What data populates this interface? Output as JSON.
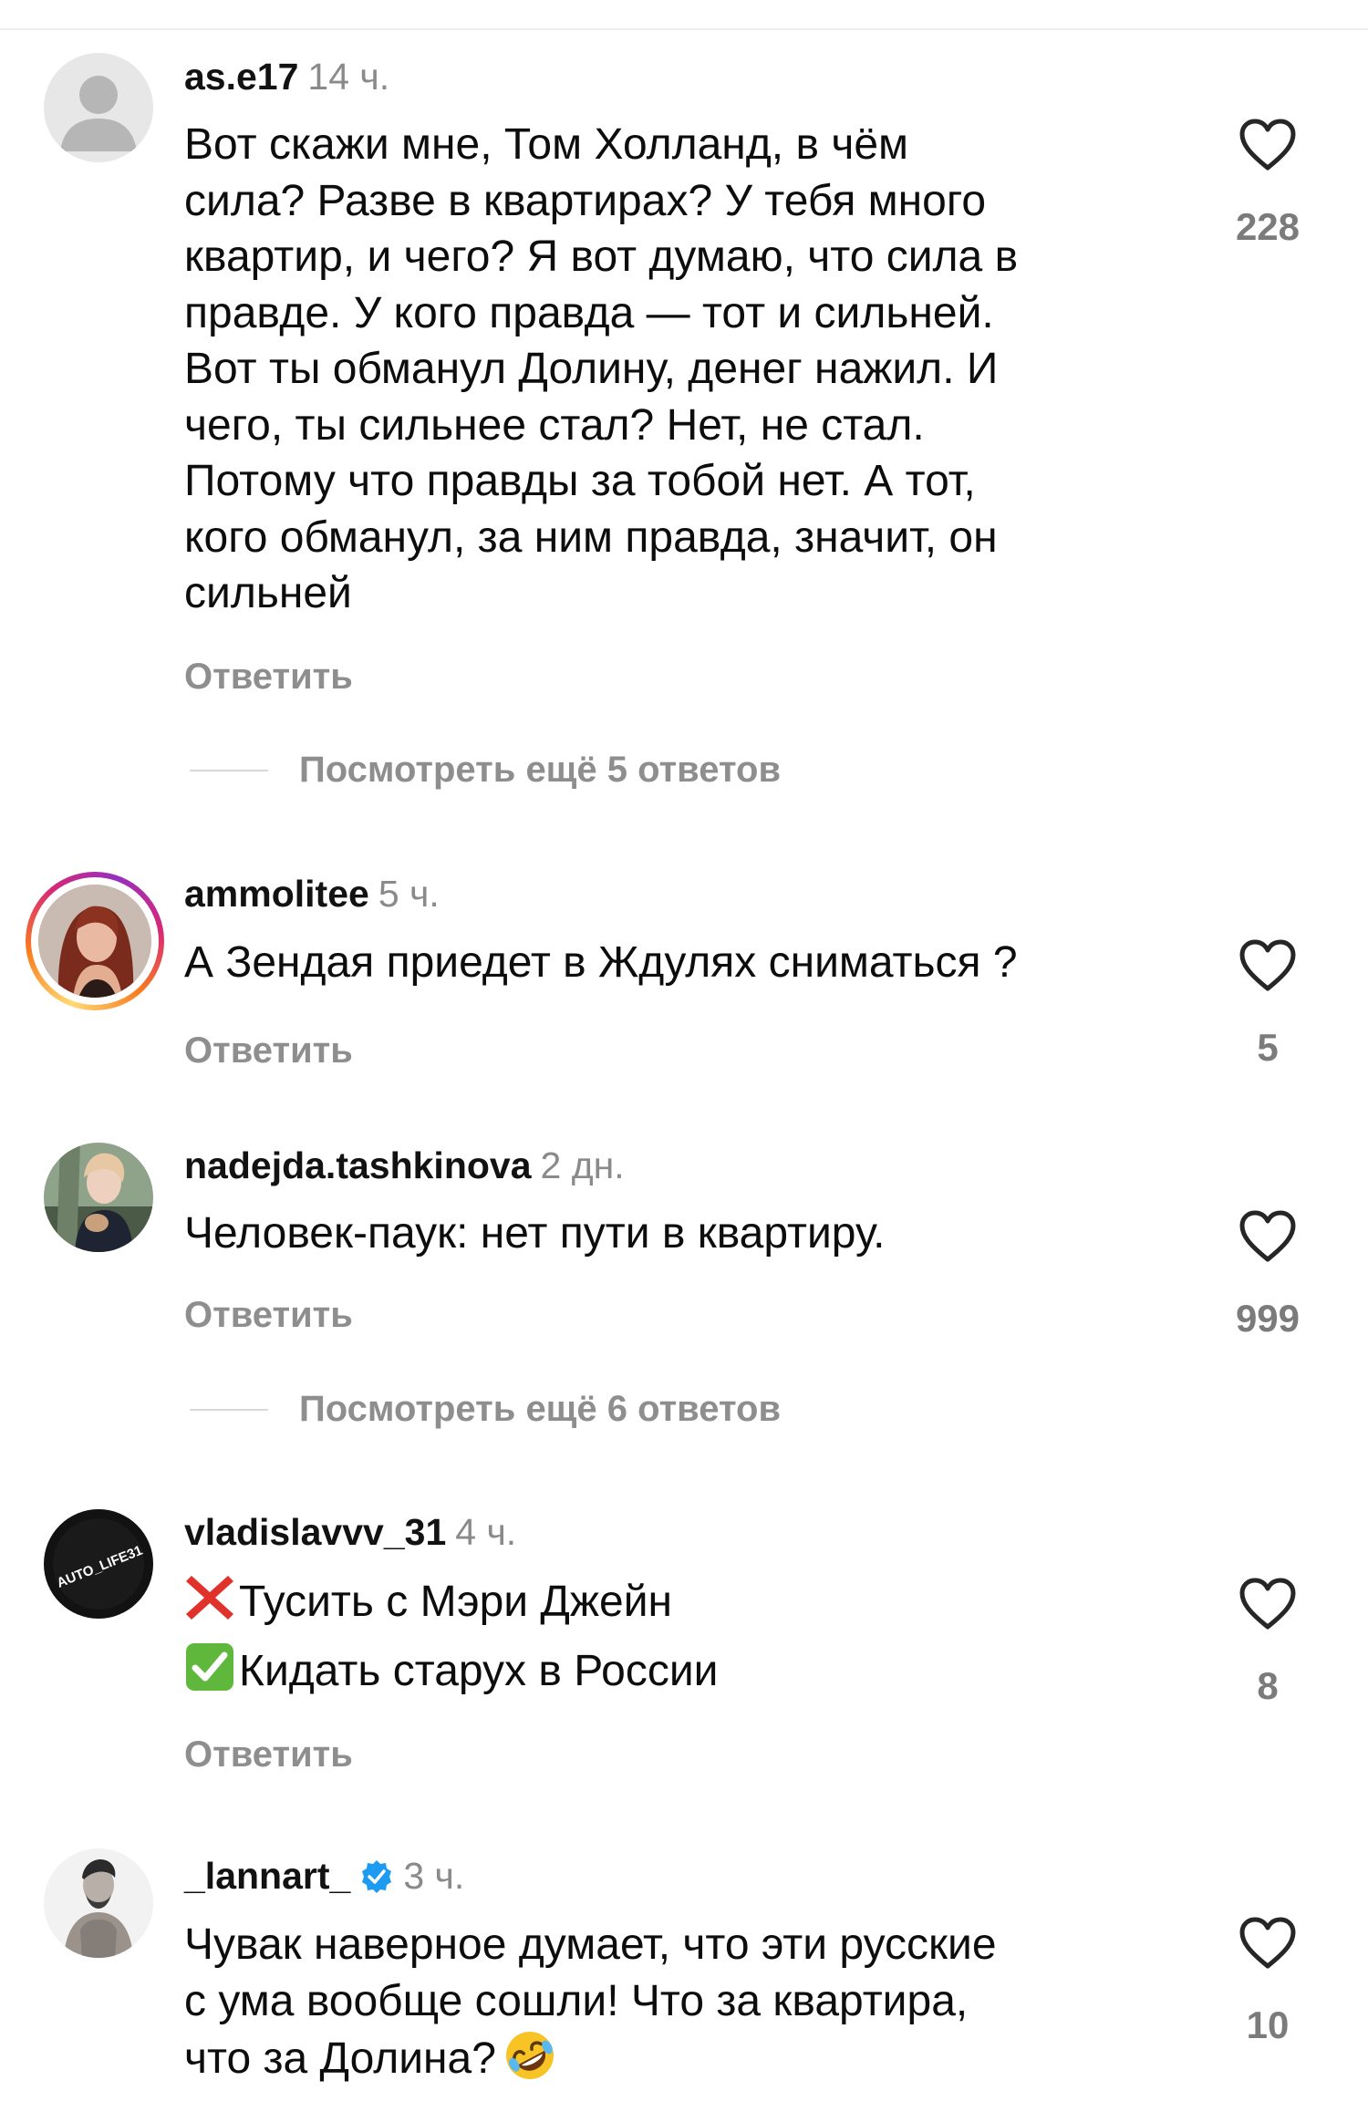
{
  "comments": [
    {
      "username": "as.e17",
      "time": "14 ч.",
      "text": "Вот скажи мне, Том Холланд, в чём\nсила? Разве в квартирах? У тебя много\nквартир, и чего? Я вот думаю, что сила в\nправде. У кого правда — тот и сильней.\nВот ты обманул Долину, денег нажил. И\nчего, ты сильнее стал? Нет, не стал.\nПотому что правды за тобой нет. А тот,\nкого обманул, за ним правда, значит, он\nсильней",
      "reply_label": "Ответить",
      "likes": "228",
      "avatar_icon": "default-user-icon",
      "view_more": "Посмотреть ещё 5 ответов"
    },
    {
      "username": "ammolitee",
      "time": "5 ч.",
      "text": "А Зендая приедет в Ждулях сниматься ?",
      "reply_label": "Ответить",
      "likes": "5",
      "avatar_icon": "user-photo-icon",
      "has_story_ring": true
    },
    {
      "username": "nadejda.tashkinova",
      "time": "2 дн.",
      "text": "Человек-паук: нет пути в квартиру.",
      "reply_label": "Ответить",
      "likes": "999",
      "avatar_icon": "user-photo-icon",
      "view_more": "Посмотреть ещё 6 ответов"
    },
    {
      "username": "vladislavvv_31",
      "time": "4 ч.",
      "line1": "Тусить с Мэри Джейн",
      "line2": "Кидать старух в России",
      "line1_icon": "cross-mark-icon",
      "line2_icon": "check-mark-button-icon",
      "reply_label": "Ответить",
      "likes": "8",
      "avatar_icon": "brand-logo-icon",
      "avatar_text": "AUTO_LIFE31"
    },
    {
      "username": "_lannart_",
      "time": "3 ч.",
      "verified": true,
      "text": "Чувак наверное думает, что эти русские\nс ума вообще сошли! Что за квартира,\nчто за Долина?",
      "end_emoji": "rolling-on-floor-laughing-icon",
      "likes": "10",
      "avatar_icon": "user-photo-icon"
    }
  ],
  "colors": {
    "username": "#121212",
    "meta_gray": "#8a8a8a",
    "action_gray": "#8e8e8e",
    "verified_blue": "#1d9bf0",
    "cross_red": "#e0312a",
    "check_green": "#5fb83b"
  }
}
